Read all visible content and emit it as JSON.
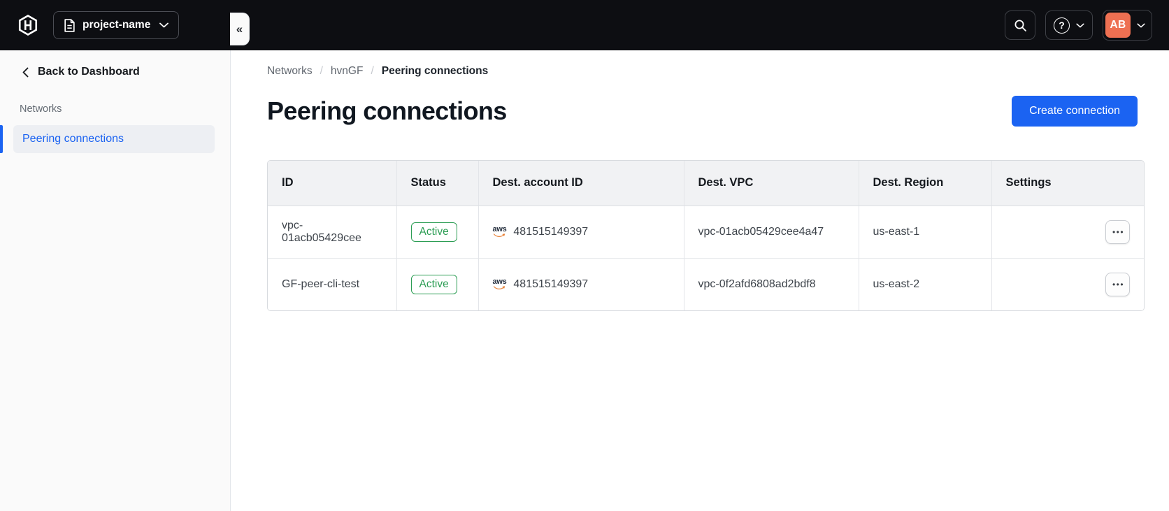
{
  "topbar": {
    "project_name": "project-name",
    "avatar_initials": "AB"
  },
  "sidebar": {
    "back_label": "Back to Dashboard",
    "section_label": "Networks",
    "active_item": "Peering connections"
  },
  "breadcrumb": {
    "items": [
      "Networks",
      "hvnGF",
      "Peering connections"
    ],
    "separator": "/"
  },
  "page": {
    "title": "Peering connections",
    "create_button": "Create connection"
  },
  "table": {
    "columns": [
      "ID",
      "Status",
      "Dest. account ID",
      "Dest. VPC",
      "Dest. Region",
      "Settings"
    ],
    "rows": [
      {
        "id": "vpc-01acb05429cee",
        "status": "Active",
        "dest_account_id": "481515149397",
        "dest_vpc": "vpc-01acb05429cee4a47",
        "dest_region": "us-east-1"
      },
      {
        "id": "GF-peer-cli-test",
        "status": "Active",
        "dest_account_id": "481515149397",
        "dest_vpc": "vpc-0f2afd6808ad2bdf8",
        "dest_region": "us-east-2"
      }
    ]
  },
  "icons": {
    "aws_label": "aws",
    "ellipsis": "•••",
    "collapse": "«",
    "help": "?"
  },
  "colors": {
    "topbar_bg": "#0d0e12",
    "accent_blue": "#1b63f2",
    "success_green": "#2c9d54",
    "avatar_coral": "#ee7052",
    "sidebar_bg": "#fafafa",
    "table_header_bg": "#f1f2f4"
  }
}
